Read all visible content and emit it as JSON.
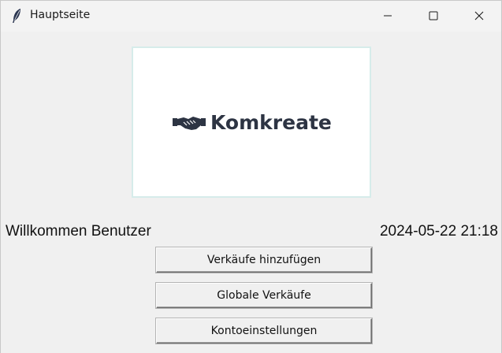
{
  "window": {
    "title": "Hauptseite",
    "icon": "feather-icon",
    "controls": [
      "minimize-icon",
      "maximize-icon",
      "close-icon"
    ]
  },
  "logo": {
    "brand_name": "Komkreate",
    "icon": "handshake-icon",
    "text_color": "#2d3443"
  },
  "status": {
    "welcome_text": "Willkommen Benutzer",
    "datetime": "2024-05-22 21:18"
  },
  "buttons": {
    "add_sales": "Verkäufe hinzufügen",
    "global_sales": "Globale Verkäufe",
    "account_settings": "Kontoeinstellungen"
  }
}
